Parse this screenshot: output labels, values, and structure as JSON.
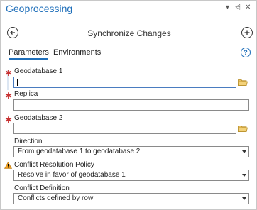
{
  "pane": {
    "title": "Geoprocessing",
    "pin_glyph": "▾",
    "autohide_glyph": "⩤",
    "close_glyph": "✕"
  },
  "tool": {
    "title": "Synchronize Changes"
  },
  "tabs": [
    {
      "label": "Parameters"
    },
    {
      "label": "Environments"
    }
  ],
  "help": {
    "glyph": "?"
  },
  "params": {
    "geodatabase1": {
      "label": "Geodatabase 1",
      "value": ""
    },
    "replica": {
      "label": "Replica",
      "value": ""
    },
    "geodatabase2": {
      "label": "Geodatabase 2",
      "value": ""
    },
    "direction": {
      "label": "Direction",
      "value": "From geodatabase 1 to geodatabase 2"
    },
    "conflict_policy": {
      "label": "Conflict Resolution Policy",
      "value": "Resolve in favor of geodatabase 1"
    },
    "conflict_definition": {
      "label": "Conflict Definition",
      "value": "Conflicts defined by row"
    }
  },
  "required_marker": "✱",
  "colors": {
    "accent": "#1f6fba",
    "required": "#c83232",
    "folder": "#e0b040",
    "warning": "#f0a020"
  }
}
